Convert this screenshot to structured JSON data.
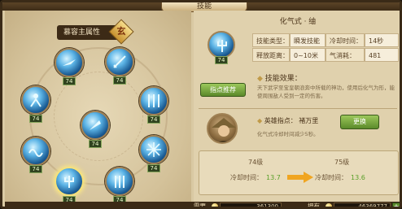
{
  "window": {
    "title": "技能"
  },
  "left_panel": {
    "attribute_label": "慕容主属性",
    "attribute_value": "玄"
  },
  "skills": [
    {
      "name": "skill-1",
      "level": "74"
    },
    {
      "name": "skill-2",
      "level": "74"
    },
    {
      "name": "skill-3",
      "level": "74"
    },
    {
      "name": "skill-4",
      "level": "74"
    },
    {
      "name": "skill-5",
      "level": "74"
    },
    {
      "name": "skill-6",
      "level": "74"
    },
    {
      "name": "skill-7",
      "level": "74"
    },
    {
      "name": "skill-8",
      "level": "74"
    },
    {
      "name": "skill-9",
      "level": "74"
    },
    {
      "name": "skill-10",
      "level": "74"
    }
  ],
  "detail": {
    "skill_name": "化气式 · 䌷",
    "icon_level": "74",
    "type_label": "技能类型：",
    "type_value": "瞬发技能",
    "cooldown_label": "冷却时间：",
    "cooldown_value": "14秒",
    "range_label": "释放距离：",
    "range_value": "0~10米",
    "cost_label": "气消耗：",
    "cost_value": "481",
    "effect_title": "技能效果：",
    "effect_desc": "天下武学至宝皇朝浪奔中所载的神功，使用后化气为形，能使周围敌人受到一定的伤害。",
    "recommend_button": "指点推荐",
    "hero_label": "英雄指点：",
    "hero_name": "褚万里",
    "hero_desc": "化气式冷却时间减少5秒。",
    "change_button": "更换"
  },
  "upgrade": {
    "current_level": "74级",
    "next_level": "75级",
    "current_cd_label": "冷却时间：",
    "current_cd_value": "13.7",
    "next_cd_label": "冷却时间：",
    "next_cd_value": "13.6"
  },
  "bottom": {
    "need_label": "需要",
    "need_value": "361300",
    "own_label": "拥有",
    "own_value": "46369777",
    "plus": "+"
  }
}
